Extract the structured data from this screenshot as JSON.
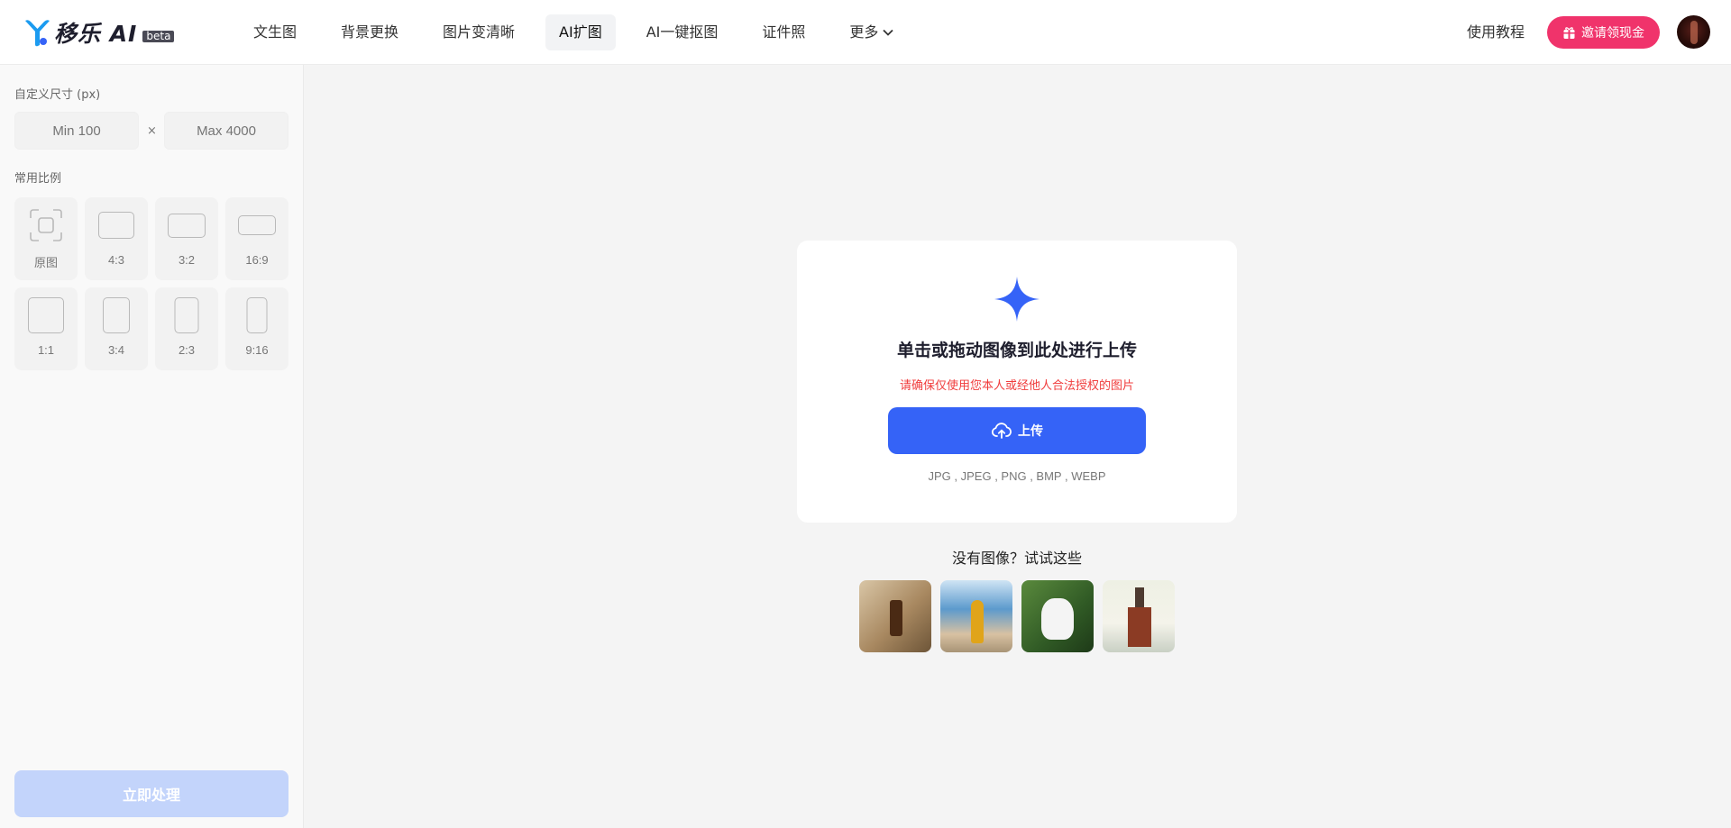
{
  "header": {
    "logo_text": "移乐 AI",
    "logo_badge": "beta",
    "nav": [
      {
        "label": "文生图",
        "active": false
      },
      {
        "label": "背景更换",
        "active": false
      },
      {
        "label": "图片变清晰",
        "active": false
      },
      {
        "label": "AI扩图",
        "active": true
      },
      {
        "label": "AI一键抠图",
        "active": false
      },
      {
        "label": "证件照",
        "active": false
      }
    ],
    "more_label": "更多",
    "tutorial_label": "使用教程",
    "invite_label": "邀请领现金",
    "colors": {
      "invite": "#f0336b",
      "accent": "#3563f7"
    }
  },
  "sidebar": {
    "custom_size_title": "自定义尺寸 (px)",
    "width_placeholder": "Min 100",
    "height_placeholder": "Max 4000",
    "times": "×",
    "ratio_title": "常用比例",
    "ratios": [
      {
        "label": "原图",
        "icon": "original-frame-icon"
      },
      {
        "label": "4:3"
      },
      {
        "label": "3:2"
      },
      {
        "label": "16:9"
      },
      {
        "label": "1:1"
      },
      {
        "label": "3:4"
      },
      {
        "label": "2:3"
      },
      {
        "label": "9:16"
      }
    ],
    "process_label": "立即处理"
  },
  "upload": {
    "title": "单击或拖动图像到此处进行上传",
    "warning": "请确保仅使用您本人或经他人合法授权的图片",
    "button_label": "上传",
    "formats": "JPG , JPEG , PNG , BMP , WEBP"
  },
  "samples": {
    "title": "没有图像？试试这些"
  }
}
